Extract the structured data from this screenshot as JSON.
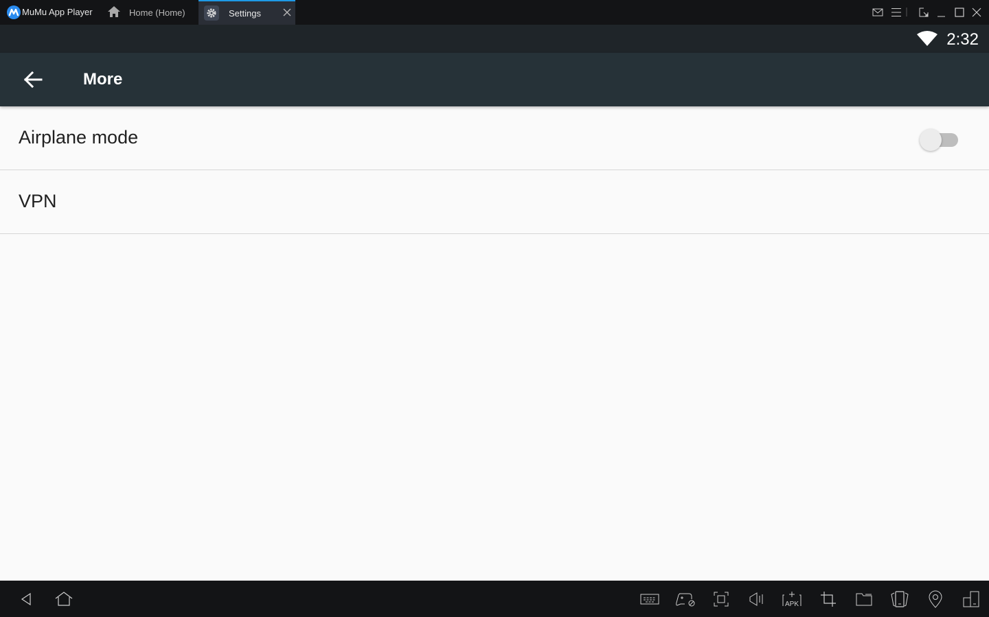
{
  "titlebar": {
    "app_name": "MuMu App Player",
    "tabs": [
      {
        "label": "Home (Home)",
        "icon": "home-icon",
        "active": false
      },
      {
        "label": "Settings",
        "icon": "gear-icon",
        "active": true
      }
    ],
    "controls": [
      "mail-icon",
      "menu-icon",
      "screen-icon",
      "minimize-icon",
      "maximize-icon",
      "close-icon"
    ]
  },
  "statusbar": {
    "time": "2:32",
    "wifi": "wifi-icon"
  },
  "appbar": {
    "title": "More"
  },
  "settings": {
    "items": [
      {
        "label": "Airplane mode",
        "toggle": false
      },
      {
        "label": "VPN"
      }
    ]
  },
  "navbar": {
    "left": [
      "back-icon",
      "home-icon"
    ],
    "tools": [
      "keyboard-icon",
      "gamepad-icon",
      "screenshot-icon",
      "volume-icon",
      "apk-install-icon",
      "crop-icon",
      "folder-icon",
      "rotate-icon",
      "location-icon",
      "multi-window-icon"
    ]
  }
}
